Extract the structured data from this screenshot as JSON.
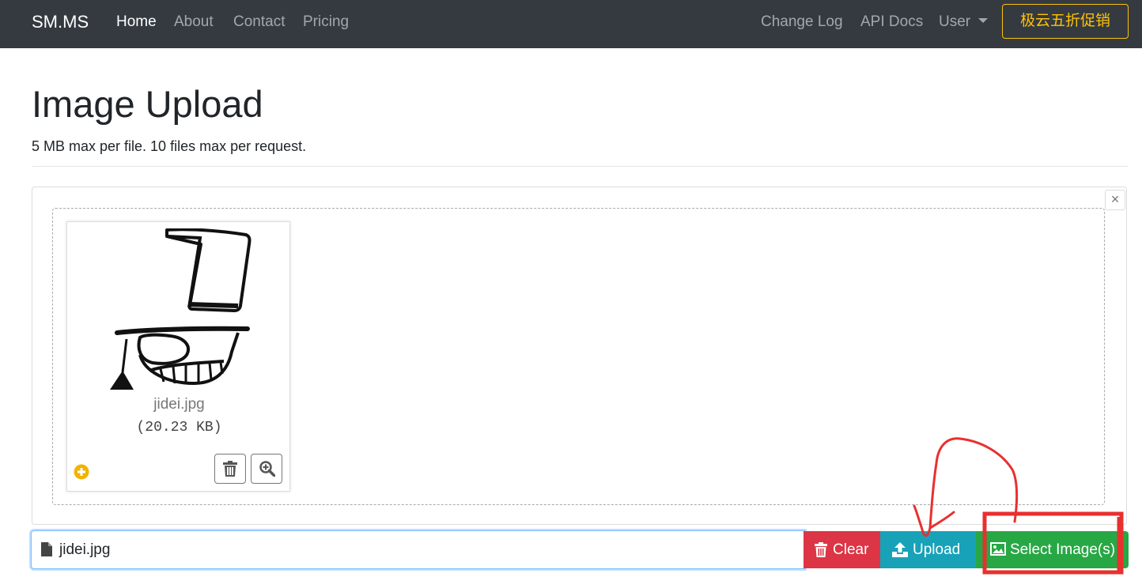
{
  "navbar": {
    "brand": "SM.MS",
    "left_links": [
      "Home",
      "About",
      "Contact",
      "Pricing"
    ],
    "active_link": "Home",
    "right_links": [
      "Change Log",
      "API Docs"
    ],
    "user_menu": "User",
    "promo_button": "极云五折促销"
  },
  "page": {
    "title": "Image Upload",
    "subtitle": "5 MB max per file. 10 files max per request."
  },
  "preview": {
    "file_name": "jidei.jpg",
    "file_size": "(20.23 KB)",
    "close_symbol": "×",
    "icons": [
      "plus-circle-icon",
      "trash-icon",
      "zoom-in-icon"
    ]
  },
  "input_group": {
    "file_caption": "jidei.jpg",
    "clear_label": "Clear",
    "upload_label": "Upload",
    "select_label": "Select Image(s)"
  },
  "colors": {
    "navbar_bg": "#343a40",
    "promo": "#ffc107",
    "clear": "#dc3545",
    "upload": "#17a2b8",
    "select": "#28a745",
    "annotation": "#e8302f"
  }
}
